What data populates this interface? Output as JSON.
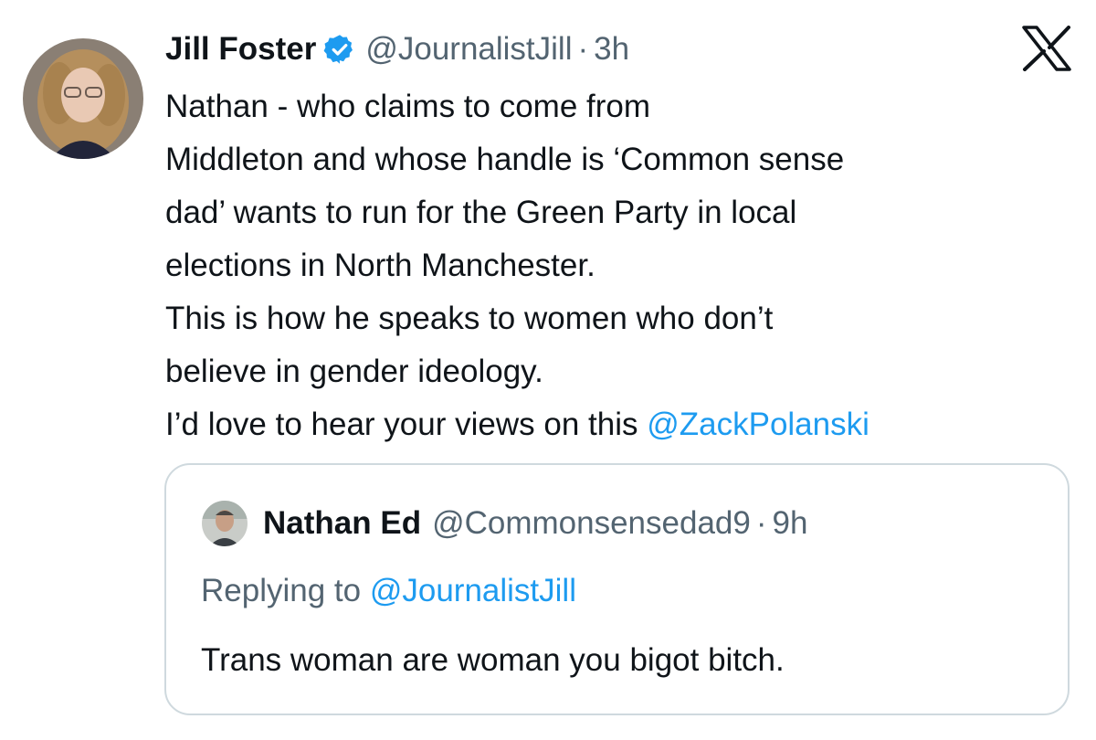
{
  "tweet": {
    "author": {
      "display_name": "Jill Foster",
      "handle": "@JournalistJill",
      "verified_icon": "verified-badge-icon",
      "separator": "·",
      "time": "3h"
    },
    "platform_icon": "x-logo-icon",
    "body_lines": [
      "Nathan - who claims to come from",
      "Middleton and whose handle is ‘Common sense",
      "dad’ wants to run for the Green Party in local",
      "elections in North Manchester.",
      "This is how he speaks to women who don’t",
      "believe in gender ideology."
    ],
    "last_line_text": "I’d love to hear your views on this ",
    "last_line_mention": "@ZackPolanski"
  },
  "quoted_tweet": {
    "author": {
      "display_name": "Nathan Ed",
      "handle": "@Commonsensedad9",
      "separator": "·",
      "time": "9h"
    },
    "replying_to_label": "Replying to ",
    "replying_to_handle": "@JournalistJill",
    "text": "Trans woman are woman you bigot bitch."
  },
  "colors": {
    "text": "#0f1419",
    "secondary": "#536471",
    "link": "#1d9bf0",
    "verified": "#1d9bf0",
    "border": "#cfd9de"
  }
}
